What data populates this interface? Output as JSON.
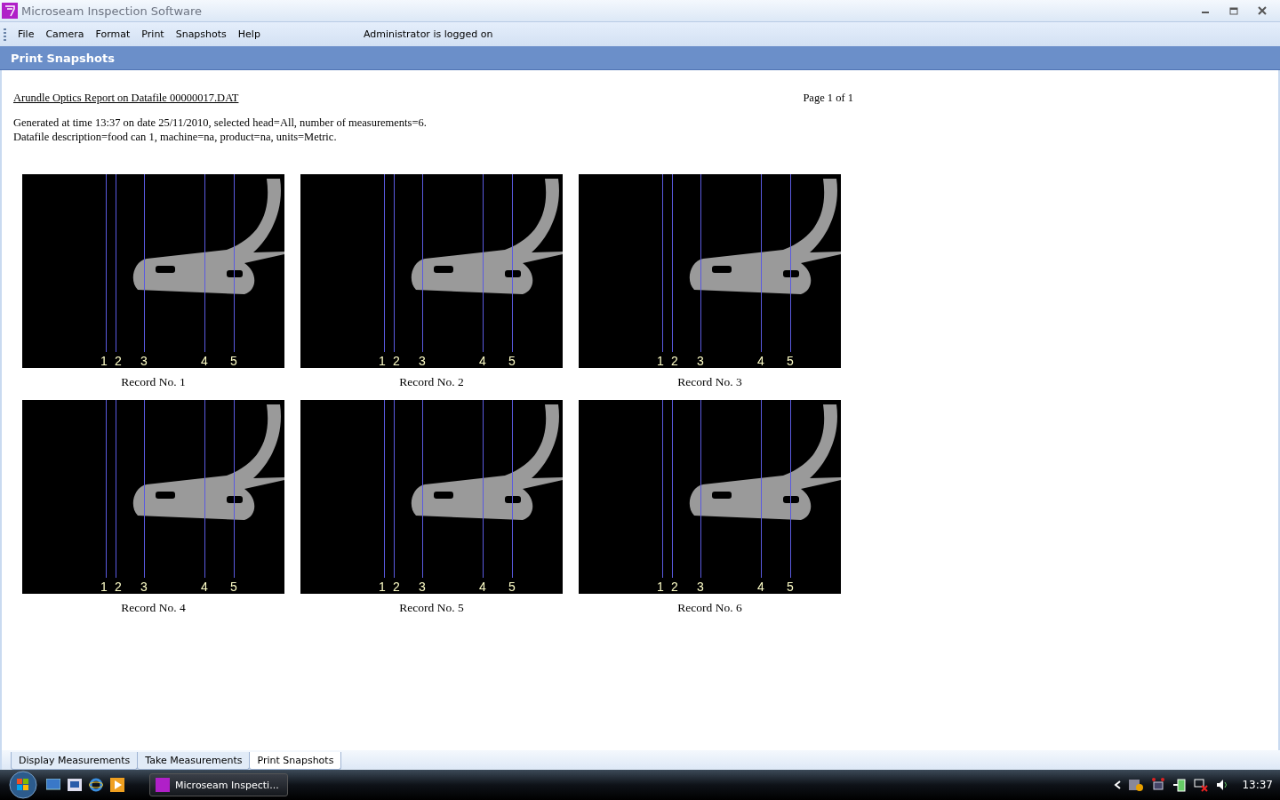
{
  "window": {
    "title": "Microseam Inspection Software"
  },
  "menu": [
    {
      "label": "File"
    },
    {
      "label": "Camera"
    },
    {
      "label": "Format"
    },
    {
      "label": "Print"
    },
    {
      "label": "Snapshots"
    },
    {
      "label": "Help"
    }
  ],
  "login_status": "Administrator is logged on",
  "panel_title": "Print Snapshots",
  "report": {
    "heading": "Arundle Optics Report on Datafile 00000017.DAT",
    "page": "Page 1 of 1",
    "lines": [
      "Generated at time 13:37 on date 25/11/2010, selected head=All, number of measurements=6.",
      "Datafile description=food can 1, machine=na, product=na, units=Metric."
    ]
  },
  "snapshots": [
    {
      "caption": "Record No. 1",
      "markers": [
        "1",
        "2",
        "3",
        "4",
        "5"
      ]
    },
    {
      "caption": "Record No. 2",
      "markers": [
        "1",
        "2",
        "3",
        "4",
        "5"
      ]
    },
    {
      "caption": "Record No. 3",
      "markers": [
        "1",
        "2",
        "3",
        "4",
        "5"
      ]
    },
    {
      "caption": "Record No. 4",
      "markers": [
        "1",
        "2",
        "3",
        "4",
        "5"
      ]
    },
    {
      "caption": "Record No. 5",
      "markers": [
        "1",
        "2",
        "3",
        "4",
        "5"
      ]
    },
    {
      "caption": "Record No. 6",
      "markers": [
        "1",
        "2",
        "3",
        "4",
        "5"
      ]
    }
  ],
  "bottom_tabs": [
    {
      "label": "Display Measurements",
      "selected": false
    },
    {
      "label": "Take Measurements",
      "selected": false
    },
    {
      "label": "Print Snapshots",
      "selected": true
    }
  ],
  "taskbar": {
    "task": "Microseam Inspecti...",
    "clock": "13:37"
  }
}
